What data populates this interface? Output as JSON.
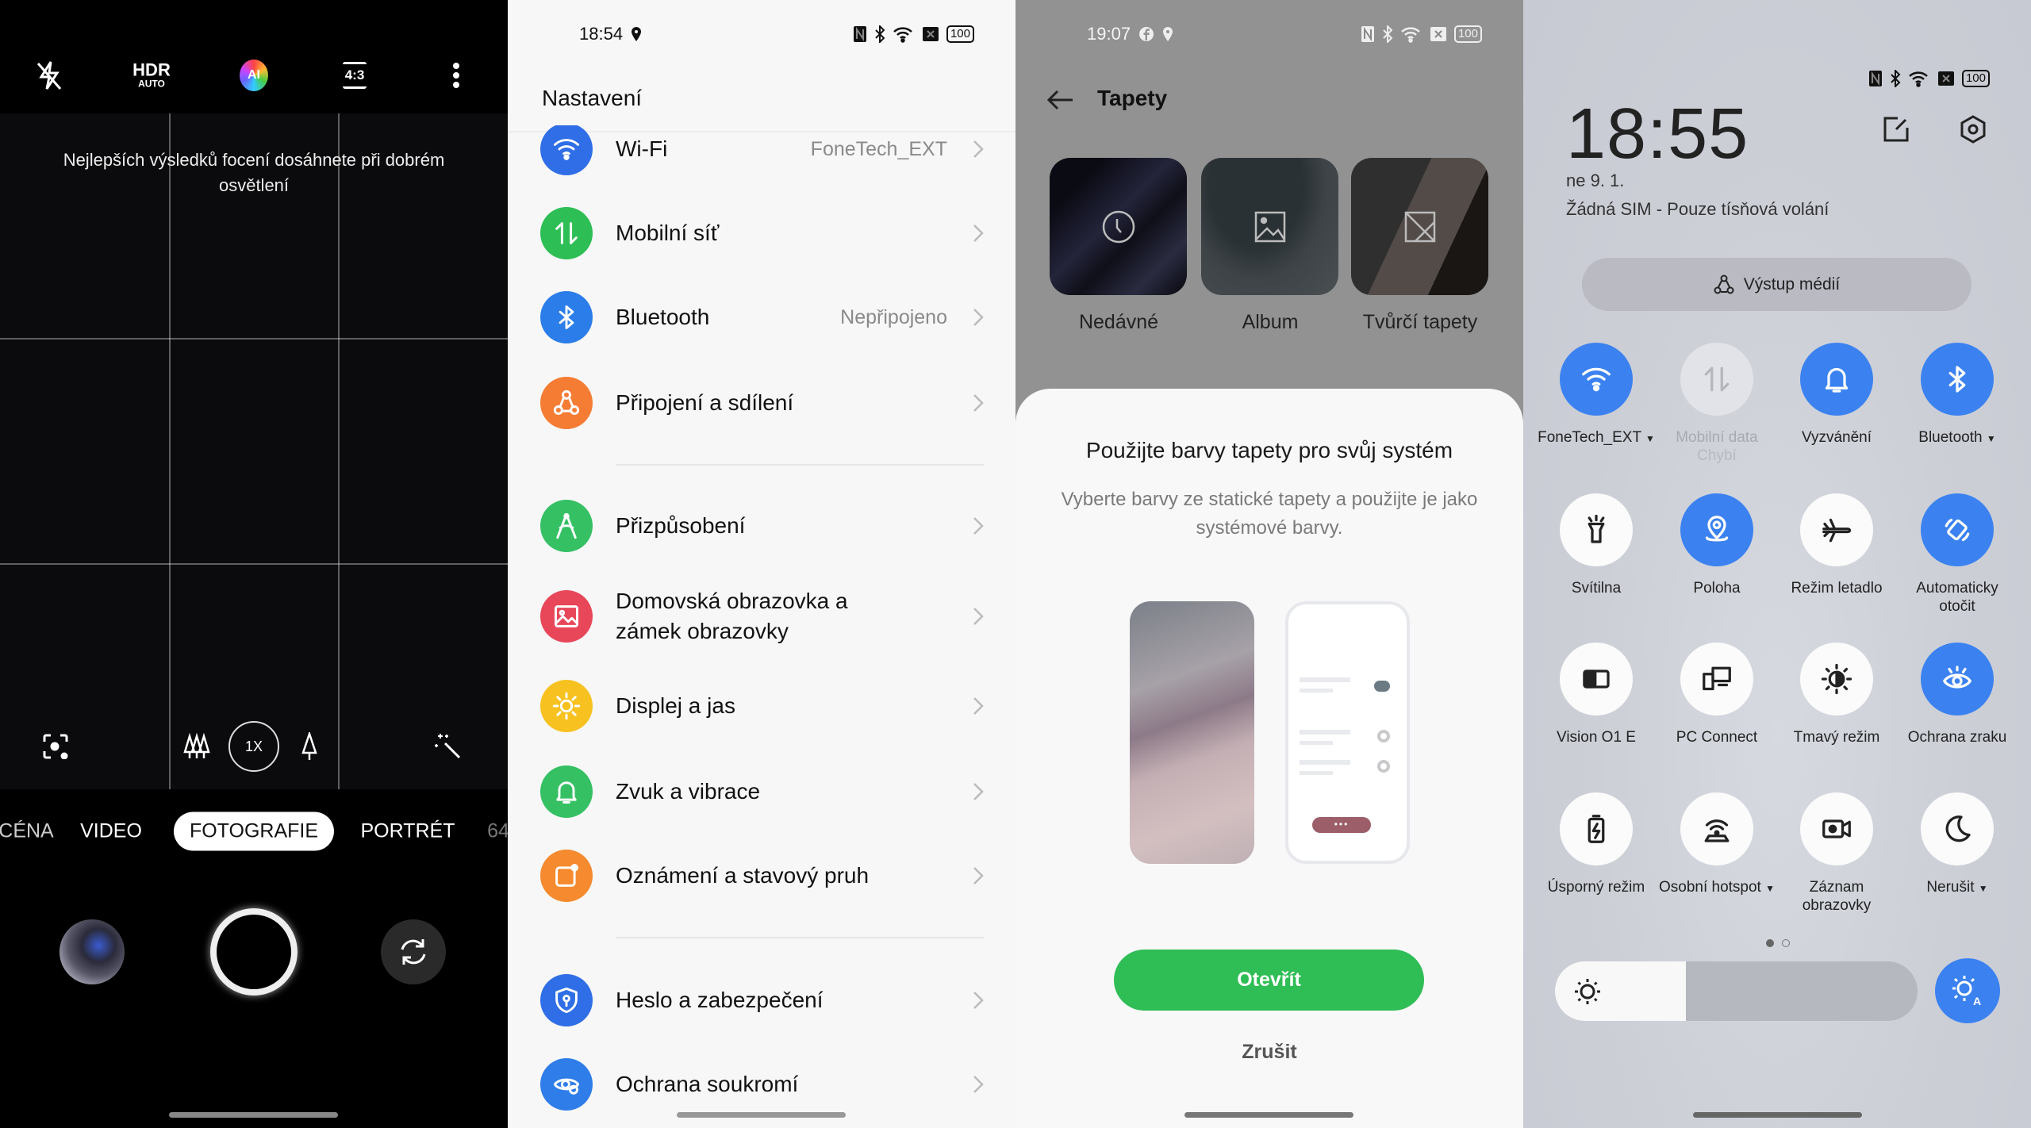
{
  "camera": {
    "top_icons": [
      "flash-off-icon",
      "hdr-auto-icon",
      "ai-icon",
      "aspect-ratio-icon",
      "more-icon"
    ],
    "hdr_label": "HDR",
    "hdr_sub": "AUTO",
    "ai_label": "AI",
    "aspect_label": "4:3",
    "hint": "Nejlepších výsledků focení dosáhnete při dobrém osvětlení",
    "zoom_label": "1X",
    "modes": [
      "CÉNA",
      "VIDEO",
      "FOTOGRAFIE",
      "PORTRÉT",
      "64"
    ],
    "selected_mode": "FOTOGRAFIE"
  },
  "settings": {
    "status_time": "18:54",
    "battery": "100",
    "title": "Nastavení",
    "items": [
      {
        "label": "Wi-Fi",
        "value": "FoneTech_EXT",
        "icon": "wifi",
        "color": "#2f6ee6"
      },
      {
        "label": "Mobilní síť",
        "value": "",
        "icon": "mobile-data",
        "color": "#2dbf55"
      },
      {
        "label": "Bluetooth",
        "value": "Nepřipojeno",
        "icon": "bluetooth",
        "color": "#2b7de9"
      },
      {
        "label": "Připojení a sdílení",
        "value": "",
        "icon": "share",
        "color": "#f57c33"
      },
      {
        "label": "Přizpůsobení",
        "value": "",
        "icon": "personalize",
        "color": "#35c064"
      },
      {
        "label": "Domovská obrazovka a zámek obrazovky",
        "value": "",
        "icon": "image",
        "color": "#e8475a"
      },
      {
        "label": "Displej a jas",
        "value": "",
        "icon": "sun",
        "color": "#f7c120"
      },
      {
        "label": "Zvuk a vibrace",
        "value": "",
        "icon": "bell",
        "color": "#35c064"
      },
      {
        "label": "Oznámení a stavový pruh",
        "value": "",
        "icon": "notification",
        "color": "#f58a2e"
      },
      {
        "label": "Heslo a zabezpečení",
        "value": "",
        "icon": "shield",
        "color": "#2f6ee6"
      },
      {
        "label": "Ochrana soukromí",
        "value": "",
        "icon": "privacy",
        "color": "#2f7de9"
      }
    ]
  },
  "wallpaper": {
    "status_time": "19:07",
    "battery": "100",
    "title": "Tapety",
    "categories": [
      "Nedávné",
      "Album",
      "Tvůrčí tapety"
    ],
    "dialog": {
      "title": "Použijte barvy tapety pro svůj systém",
      "description": "Vyberte barvy ze statické tapety a použijte je jako systémové barvy.",
      "open_label": "Otevřít",
      "cancel_label": "Zrušit",
      "accent": "#2fbd55",
      "preview_accent": "#9c5f6a"
    }
  },
  "control_center": {
    "battery": "100",
    "time": "18:55",
    "date": "ne 9. 1.",
    "sim_status": "Žádná SIM - Pouze tísňová volání",
    "media_output": "Výstup médií",
    "accent": "#3b82f0",
    "tiles": [
      {
        "label": "FoneTech_EXT",
        "icon": "wifi",
        "state": "on",
        "dropdown": true
      },
      {
        "label": "Mobilní data",
        "sub": "Chybí",
        "icon": "mobile-data",
        "state": "disabled"
      },
      {
        "label": "Vyzvánění",
        "icon": "bell",
        "state": "on"
      },
      {
        "label": "Bluetooth",
        "icon": "bluetooth",
        "state": "on",
        "dropdown": true
      },
      {
        "label": "Svítilna",
        "icon": "flashlight",
        "state": "off"
      },
      {
        "label": "Poloha",
        "icon": "location",
        "state": "on"
      },
      {
        "label": "Režim letadlo",
        "icon": "airplane",
        "state": "off"
      },
      {
        "label": "Automaticky otočit",
        "icon": "rotate",
        "state": "on"
      },
      {
        "label": "Vision O1 E",
        "icon": "screencast",
        "state": "off"
      },
      {
        "label": "PC Connect",
        "icon": "pc-connect",
        "state": "off"
      },
      {
        "label": "Tmavý režim",
        "icon": "dark-mode",
        "state": "off"
      },
      {
        "label": "Ochrana zraku",
        "icon": "eye",
        "state": "on"
      },
      {
        "label": "Úsporný režim",
        "icon": "battery-saver",
        "state": "off"
      },
      {
        "label": "Osobní hotspot",
        "icon": "hotspot",
        "state": "off",
        "dropdown": true
      },
      {
        "label": "Záznam obrazovky",
        "icon": "screen-record",
        "state": "off"
      },
      {
        "label": "Nerušit",
        "icon": "moon",
        "state": "off",
        "dropdown": true
      }
    ],
    "page_count": 2,
    "current_page": 1,
    "brightness_percent": 36,
    "auto_brightness": true
  }
}
